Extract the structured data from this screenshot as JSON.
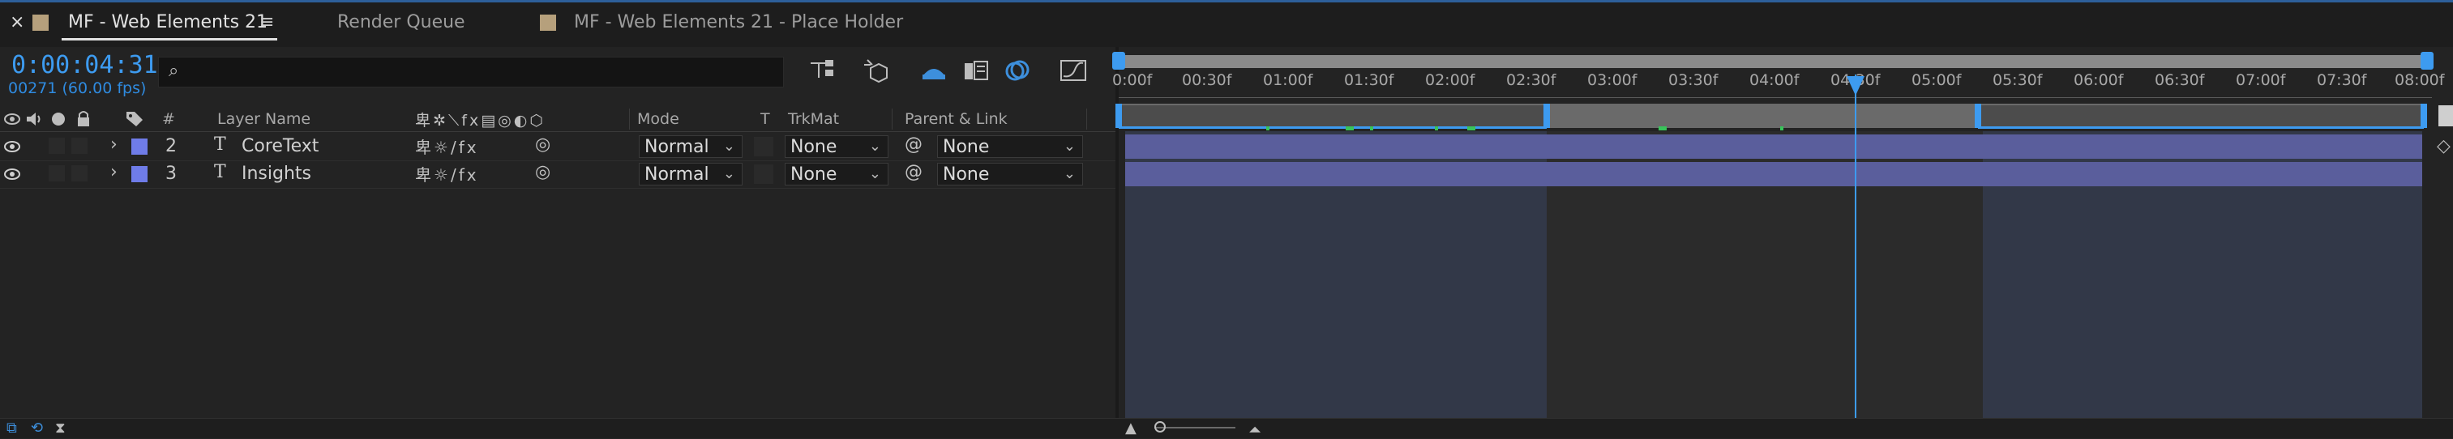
{
  "tabs": [
    {
      "label": "MF - Web Elements 21",
      "active": true
    },
    {
      "label": "Render Queue",
      "active": false
    },
    {
      "label": "MF - Web Elements 21 - Place Holder",
      "active": false
    }
  ],
  "timecode": "0:00:04:31",
  "frame_info": "00271 (60.00 fps)",
  "columns": {
    "num": "#",
    "layer_name": "Layer Name",
    "mode": "Mode",
    "t": "T",
    "trkmat": "TrkMat",
    "parent": "Parent & Link"
  },
  "layers": [
    {
      "num": "2",
      "type_glyph": "T",
      "name": "CoreText",
      "mode": "Normal",
      "trkmat": "None",
      "parent": "None"
    },
    {
      "num": "3",
      "type_glyph": "T",
      "name": "Insights",
      "mode": "Normal",
      "trkmat": "None",
      "parent": "None"
    }
  ],
  "ruler_labels": [
    "0:00f",
    "00:30f",
    "01:00f",
    "01:30f",
    "02:00f",
    "02:30f",
    "03:00f",
    "03:30f",
    "04:00f",
    "04:30f",
    "05:00f",
    "05:30f",
    "06:00f",
    "06:30f",
    "07:00f",
    "07:30f",
    "08:00f"
  ],
  "colors": {
    "accent": "#3d9bf0",
    "layer_label": "#6f7ce8",
    "layer_bar": "#5a5e9c"
  }
}
